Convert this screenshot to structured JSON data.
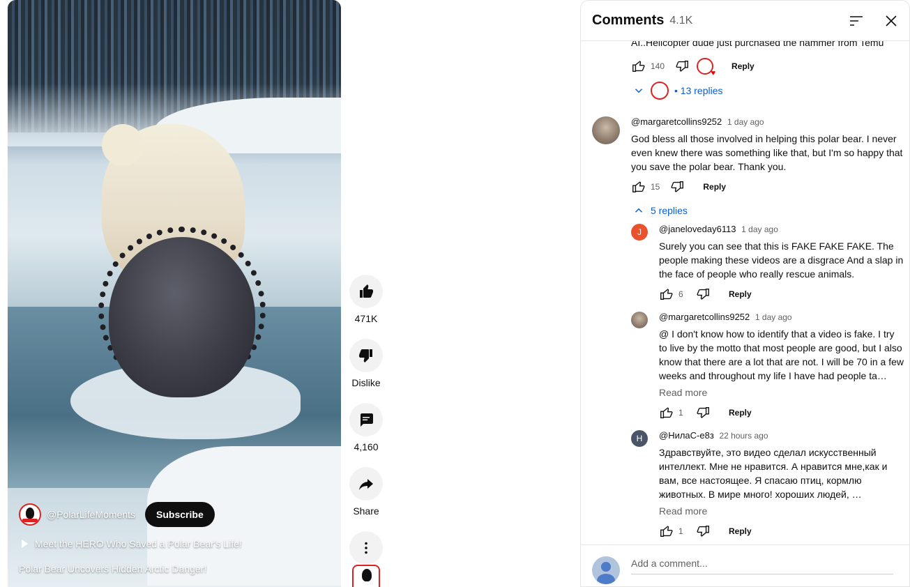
{
  "video": {
    "channel": "@PolarLifeMoments",
    "subscribe_label": "Subscribe",
    "related_title": "Meet the HERO Who Saved a Polar Bear's Life!",
    "title": "Polar Bear Uncovers Hidden Arctic Danger!"
  },
  "rail": {
    "like_count": "471K",
    "dislike_label": "Dislike",
    "comments_count": "4,160",
    "share_label": "Share"
  },
  "panel": {
    "title": "Comments",
    "count": "4.1K"
  },
  "comments": {
    "clipped_text": "AI..Helicopter dude just purchased the hammer from Temu",
    "first_likes": "140",
    "first_replies": "13 replies",
    "reply_label": "Reply",
    "read_more": "Read more",
    "main": {
      "author": "@margaretcollins9252",
      "time": "1 day ago",
      "text": "God bless all those involved in helping this polar bear. I never even knew there was something like that, but I'm so happy that you save the polar bear. Thank you.",
      "likes": "15",
      "replies_toggle": "5 replies"
    },
    "replies": [
      {
        "author": "@janeloveday6113",
        "initial": "J",
        "avatar_color": "#e8532d",
        "time": "1 day ago",
        "text": "Surely you can see that this is FAKE FAKE FAKE.  The people making these videos are a disgrace And a slap in the face of people who really rescue animals.",
        "likes": "6"
      },
      {
        "author": "@margaretcollins9252",
        "initial": "",
        "avatar_color": "photo",
        "time": "1 day ago",
        "text": "@ I don't know how to identify that a video is fake. I try to live by the motto that most people are good, but I also know that there are a lot that are not.  I will be 70 in a few weeks and throughout my life I have had people ta…",
        "likes": "1"
      },
      {
        "author": "@НилаС-е8з",
        "initial": "Н",
        "avatar_color": "#4a5568",
        "time": "22 hours ago",
        "text": "Здравствуйте, это видео сделал искусственный интеллект. Мне не нравится.  А нравится мне,как и вам, все настоящее. Я спасаю  птиц, кормлю животных. В мире много! хороших людей, …",
        "likes": "1"
      }
    ]
  },
  "add_comment_placeholder": "Add a comment..."
}
